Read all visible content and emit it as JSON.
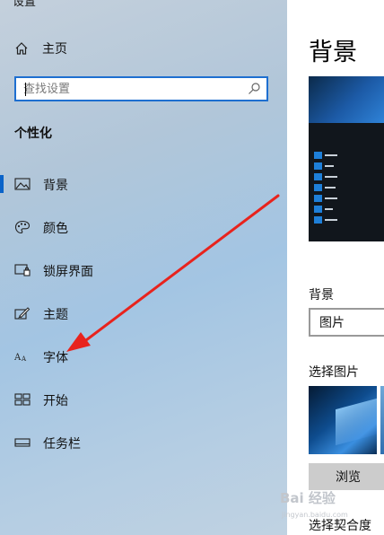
{
  "window": {
    "title": "设置"
  },
  "sidebar": {
    "home_label": "主页",
    "search": {
      "placeholder": "查找设置",
      "value": ""
    },
    "section_title": "个性化",
    "items": [
      {
        "label": "背景",
        "icon": "picture-icon",
        "selected": true
      },
      {
        "label": "颜色",
        "icon": "palette-icon",
        "selected": false
      },
      {
        "label": "锁屏界面",
        "icon": "lock-screen-icon",
        "selected": false
      },
      {
        "label": "主题",
        "icon": "theme-brush-icon",
        "selected": false
      },
      {
        "label": "字体",
        "icon": "font-icon",
        "selected": false
      },
      {
        "label": "开始",
        "icon": "start-grid-icon",
        "selected": false
      },
      {
        "label": "任务栏",
        "icon": "taskbar-icon",
        "selected": false
      }
    ]
  },
  "main": {
    "title": "背景",
    "background_label": "背景",
    "background_value": "图片",
    "choose_picture_label": "选择图片",
    "browse_label": "浏览",
    "fit_label": "选择契合度"
  },
  "watermark": {
    "text": "Bai 经验",
    "sub": "jingyan.baidu.com"
  },
  "colors": {
    "accent": "#0a63c9",
    "arrow": "#e8231d",
    "sidebar": "#a9c6e2"
  }
}
